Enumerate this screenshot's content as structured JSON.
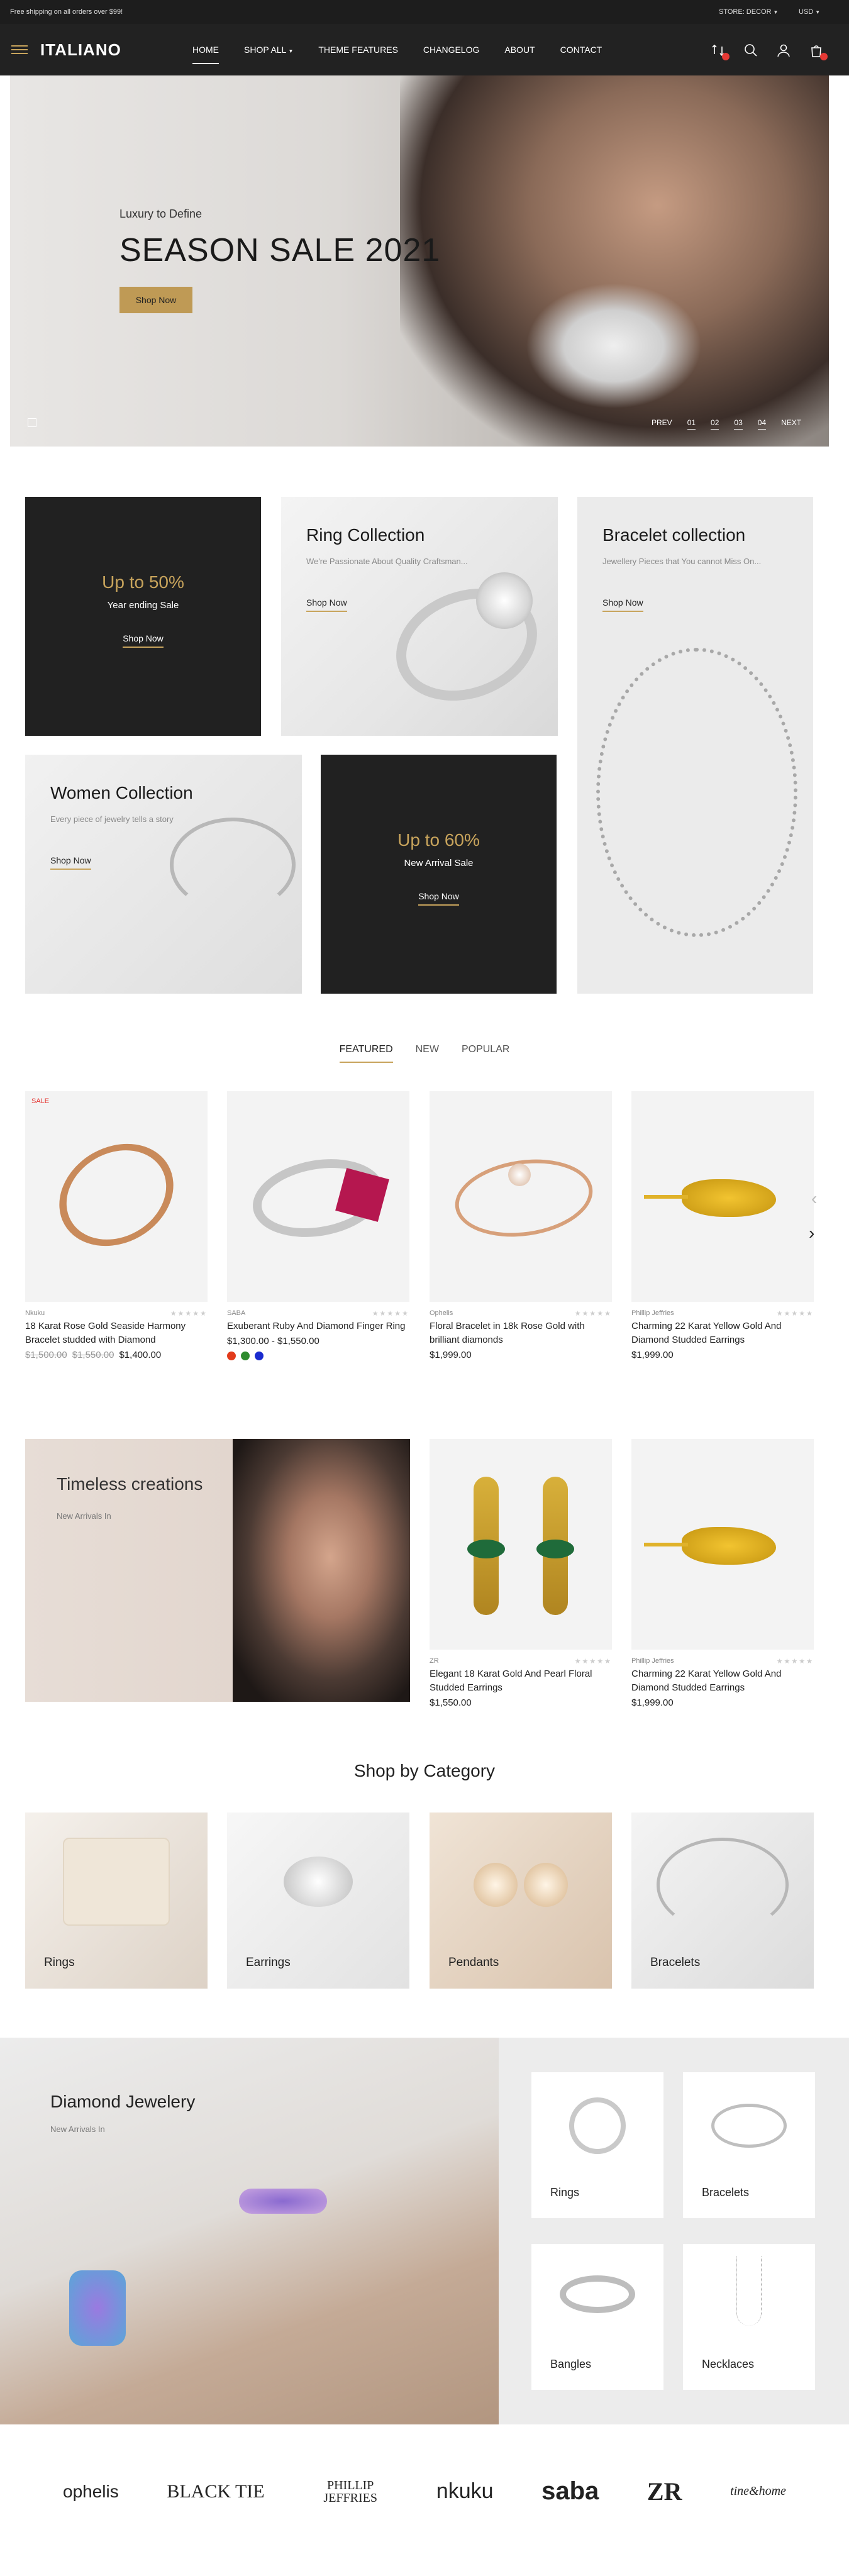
{
  "topbar": {
    "message": "Free shipping on all orders over $99!",
    "store": "STORE: DECOR",
    "currency": "USD"
  },
  "header": {
    "logo": "ITALIANO",
    "nav": [
      "HOME",
      "SHOP ALL",
      "THEME FEATURES",
      "CHANGELOG",
      "ABOUT",
      "CONTACT"
    ]
  },
  "hero": {
    "subtitle": "Luxury to Define",
    "title": "SEASON SALE 2021",
    "button": "Shop Now",
    "prev": "PREV",
    "next": "NEXT",
    "slides": [
      "01",
      "02",
      "03",
      "04"
    ]
  },
  "banners": {
    "up50": {
      "big": "Up to 50%",
      "small": "Year ending Sale",
      "link": "Shop Now"
    },
    "ring": {
      "title": "Ring Collection",
      "sub": "We're Passionate About Quality Craftsman...",
      "link": "Shop Now"
    },
    "bracelet": {
      "title": "Bracelet collection",
      "sub": "Jewellery Pieces that You cannot Miss On...",
      "link": "Shop Now"
    },
    "women": {
      "title": "Women Collection",
      "sub": "Every piece of jewelry tells a story",
      "link": "Shop Now"
    },
    "up60": {
      "big": "Up to 60%",
      "small": "New Arrival Sale",
      "link": "Shop Now"
    }
  },
  "tabs": [
    "FEATURED",
    "NEW",
    "POPULAR"
  ],
  "products": [
    {
      "brand": "Nkuku",
      "name": "18 Karat Rose Gold Seaside Harmony Bracelet studded with Diamond",
      "old1": "$1,500.00",
      "old2": "$1,550.00",
      "price": "$1,400.00",
      "sale": "SALE",
      "rating": 0
    },
    {
      "brand": "SABA",
      "name": "Exuberant Ruby And Diamond Finger Ring",
      "price": "$1,300.00 - $1,550.00",
      "swatches": [
        "#e23b1b",
        "#2e8b2e",
        "#1a2bcf"
      ],
      "rating": 0
    },
    {
      "brand": "Ophelis",
      "name": "Floral Bracelet in 18k Rose Gold with brilliant diamonds",
      "price": "$1,999.00",
      "rating": 0
    },
    {
      "brand": "Phillip Jeffries",
      "name": "Charming 22 Karat Yellow Gold And Diamond Studded Earrings",
      "price": "$1,999.00",
      "rating": 0
    }
  ],
  "promo": {
    "title": "Timeless creations",
    "sub": "New Arrivals In"
  },
  "promo_products": [
    {
      "brand": "ZR",
      "name": "Elegant 18 Karat Gold And Pearl Floral Studded Earrings",
      "price": "$1,550.00",
      "rating": 0
    },
    {
      "brand": "Phillip Jeffries",
      "name": "Charming 22 Karat Yellow Gold And Diamond Studded Earrings",
      "price": "$1,999.00",
      "rating": 0
    }
  ],
  "categories": {
    "title": "Shop by Category",
    "items": [
      "Rings",
      "Earrings",
      "Pendants",
      "Bracelets"
    ]
  },
  "diamond": {
    "title": "Diamond Jewelery",
    "sub": "New Arrivals In",
    "items": [
      "Rings",
      "Bracelets",
      "Bangles",
      "Necklaces"
    ]
  },
  "brands": [
    "ophelis",
    "BLACK TIE",
    "PHILLIP JEFFRIES",
    "nkuku",
    "saba",
    "ZR",
    "tine&home"
  ]
}
